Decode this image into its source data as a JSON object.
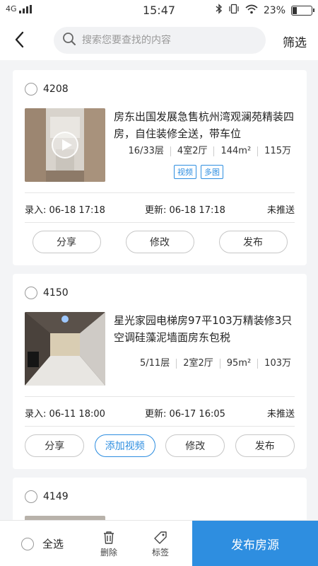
{
  "status_bar": {
    "network": "4G",
    "time": "15:47",
    "battery": "23%",
    "icons": [
      "signal-icon",
      "bluetooth-icon",
      "vibrate-icon",
      "wifi-icon",
      "battery-icon"
    ]
  },
  "header": {
    "back_icon": "back-arrow-icon",
    "search_placeholder": "搜索您要查找的内容",
    "search_icon": "search-icon",
    "filter_label": "筛选"
  },
  "listings": [
    {
      "id": "4208",
      "title": "房东出国发展急售杭州湾观澜苑精装四房，自住装修全送，带车位",
      "floor": "16/33层",
      "layout": "4室2厅",
      "area": "144m²",
      "price": "115万",
      "tags": [
        "视频",
        "多图"
      ],
      "entered": "录入: 06-18 17:18",
      "updated": "更新: 06-18 17:18",
      "status": "未推送",
      "buttons": [
        "分享",
        "修改",
        "发布"
      ],
      "has_video": true
    },
    {
      "id": "4150",
      "title": "星光家园电梯房97平103万精装修3只空调硅藻泥墙面房东包税",
      "floor": "5/11层",
      "layout": "2室2厅",
      "area": "95m²",
      "price": "103万",
      "tags": [],
      "entered": "录入: 06-11 18:00",
      "updated": "更新: 06-17 16:05",
      "status": "未推送",
      "buttons": [
        "分享",
        "添加视频",
        "修改",
        "发布"
      ],
      "has_video": false
    },
    {
      "id": "4149",
      "title": "",
      "buttons": []
    }
  ],
  "bottom_bar": {
    "select_all": "全选",
    "delete": "删除",
    "tag": "标签",
    "publish": "发布房源"
  },
  "colors": {
    "accent": "#2e8ee0",
    "background": "#f3f4f6"
  }
}
